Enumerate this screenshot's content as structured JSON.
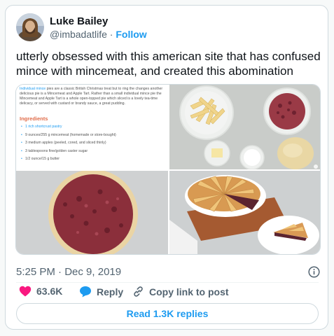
{
  "author": {
    "name": "Luke Bailey",
    "handle": "@imbadatlife",
    "separator": " · ",
    "follow_label": "Follow"
  },
  "tweet": {
    "text": "utterly obsessed with this american site that has confused mince with mincemeat, and created this abomination"
  },
  "media": {
    "recipe": {
      "lead_link": "Individual mince",
      "lead_text": " pies are a classic British Christmas treat but to ring the changes another delicious pie is a Mincemeat and Apple Tart. Rather than a small individual mince pie the Mincemeat and Apple Tart is a whole open-topped pie which sliced is a lovely tea-time delicacy, or served with custard or brandy sauce, a great pudding.",
      "ingredients_heading": "Ingredients",
      "ingredients": [
        "1 rich shortcrust pastry",
        "9 ounces/255 g mincemeat (homemade or store-bought)",
        "3 medium apples (peeled, cored, and sliced thinly)",
        "3 tablespoons fine/golden caster sugar",
        "1/2 ounce/15 g butter"
      ]
    }
  },
  "meta": {
    "time": "5:25 PM",
    "separator": " · ",
    "date": "Dec 9, 2019"
  },
  "actions": {
    "likes": "63.6K",
    "reply_label": "Reply",
    "copy_link_label": "Copy link to post"
  },
  "replies_button": "Read 1.3K replies",
  "colors": {
    "accent": "#1d9bf0",
    "like": "#f91880",
    "text": "#0f1419",
    "muted": "#536471"
  }
}
